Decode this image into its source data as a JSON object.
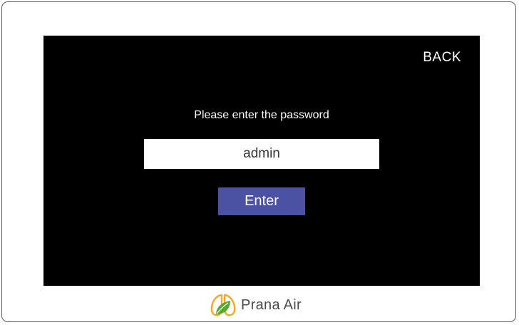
{
  "screen": {
    "back_label": "BACK",
    "prompt": "Please enter the password",
    "password_value": "admin",
    "enter_label": "Enter"
  },
  "brand": {
    "name": "Prana Air",
    "logo_icon": "lungs-leaf-icon"
  },
  "colors": {
    "screen_background": "#000000",
    "enter_button": "#4c52a3",
    "logo_orange": "#f5a623",
    "logo_green": "#5aa832"
  }
}
